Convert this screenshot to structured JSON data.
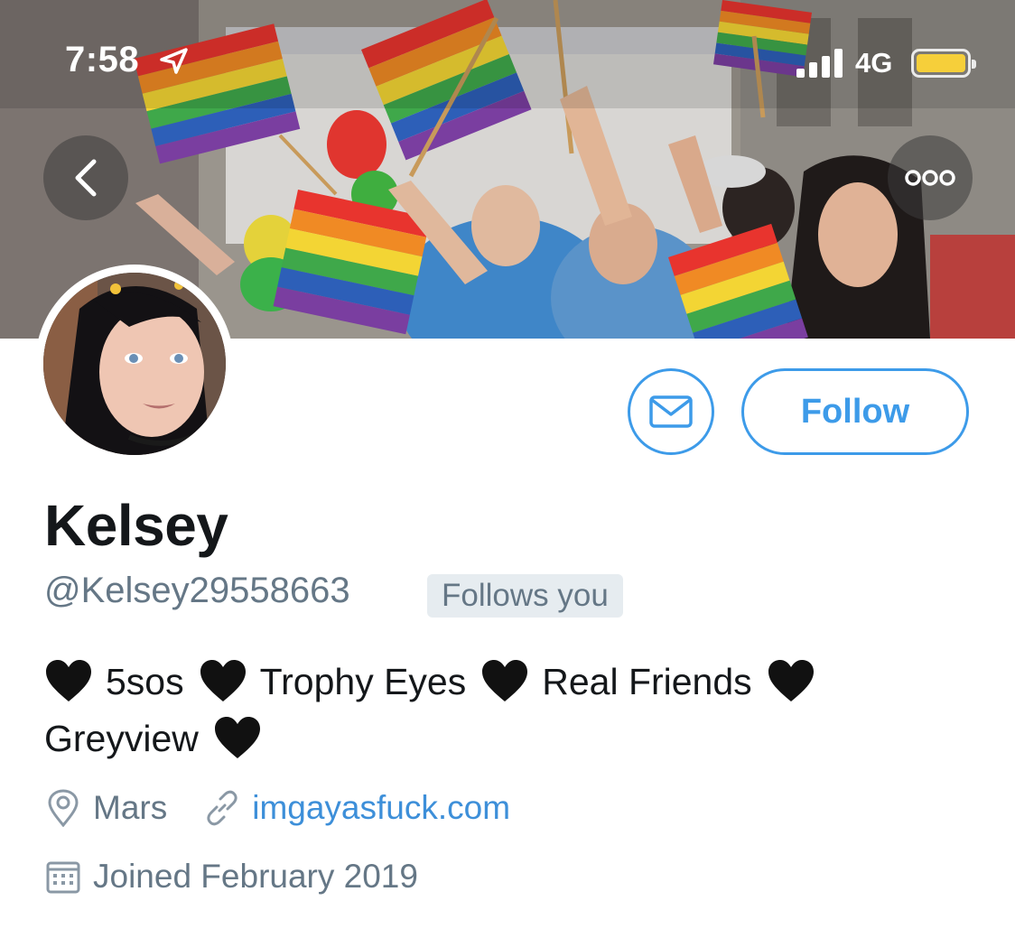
{
  "status_bar": {
    "time": "7:58",
    "network": "4G",
    "battery_color": "#f6cf3a"
  },
  "header": {
    "back_icon": "chevron-left-icon",
    "more_icon": "more-horizontal-icon"
  },
  "profile": {
    "name": "Kelsey",
    "handle": "@Kelsey29558663",
    "follows_you": "Follows you",
    "bio": [
      "5sos",
      "Trophy Eyes",
      "Real Friends",
      "Greyview"
    ],
    "location": "Mars",
    "website": "imgayasfuck.com",
    "joined": "Joined February 2019"
  },
  "actions": {
    "follow_label": "Follow",
    "message_icon": "envelope-icon"
  },
  "colors": {
    "accent": "#3d9be9",
    "link": "#3d8fd9",
    "secondary_text": "#657786",
    "badge_bg": "#e6ecf0"
  }
}
